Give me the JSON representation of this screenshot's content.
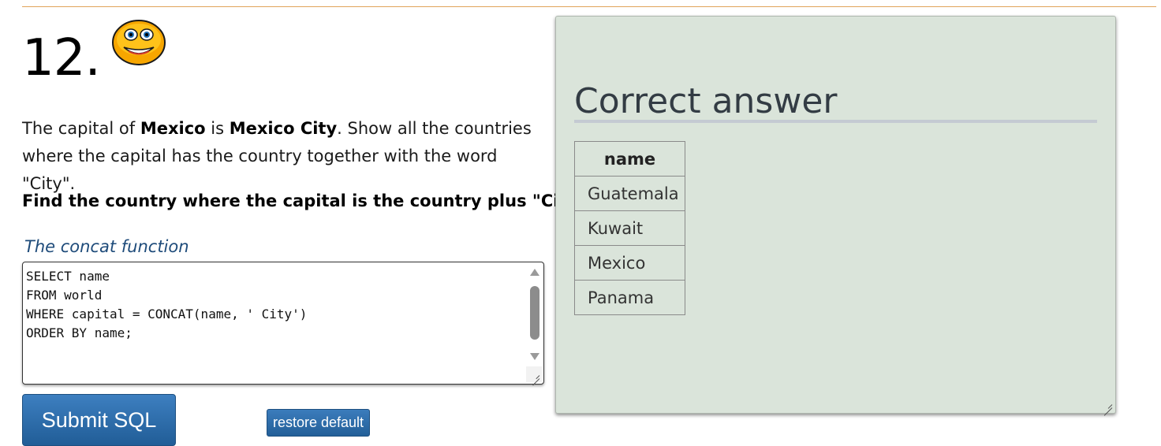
{
  "question": {
    "number": "12.",
    "prose_parts": [
      "The capital of ",
      "Mexico",
      " is ",
      "Mexico City",
      ". Show all the countries where the capital has the country together with the word \"City\"."
    ],
    "task": "Find the country where the capital is the country plus \"City\".",
    "hint_link": "The concat function"
  },
  "editor": {
    "sql": "SELECT name\nFROM world\nWHERE capital = CONCAT(name, ' City')\nORDER BY name;"
  },
  "buttons": {
    "submit_label": "Submit SQL",
    "restore_label": "restore default"
  },
  "answer": {
    "title": "Correct answer",
    "columns": [
      "name"
    ],
    "rows": [
      [
        "Guatemala"
      ],
      [
        "Kuwait"
      ],
      [
        "Mexico"
      ],
      [
        "Panama"
      ]
    ]
  },
  "colors": {
    "accent_rule": "#e0a45a",
    "button_blue": "#2c6aa8",
    "panel_bg": "#dae4da",
    "link": "#1e4b7a"
  },
  "icons": {
    "status": "smiley-face-icon"
  }
}
